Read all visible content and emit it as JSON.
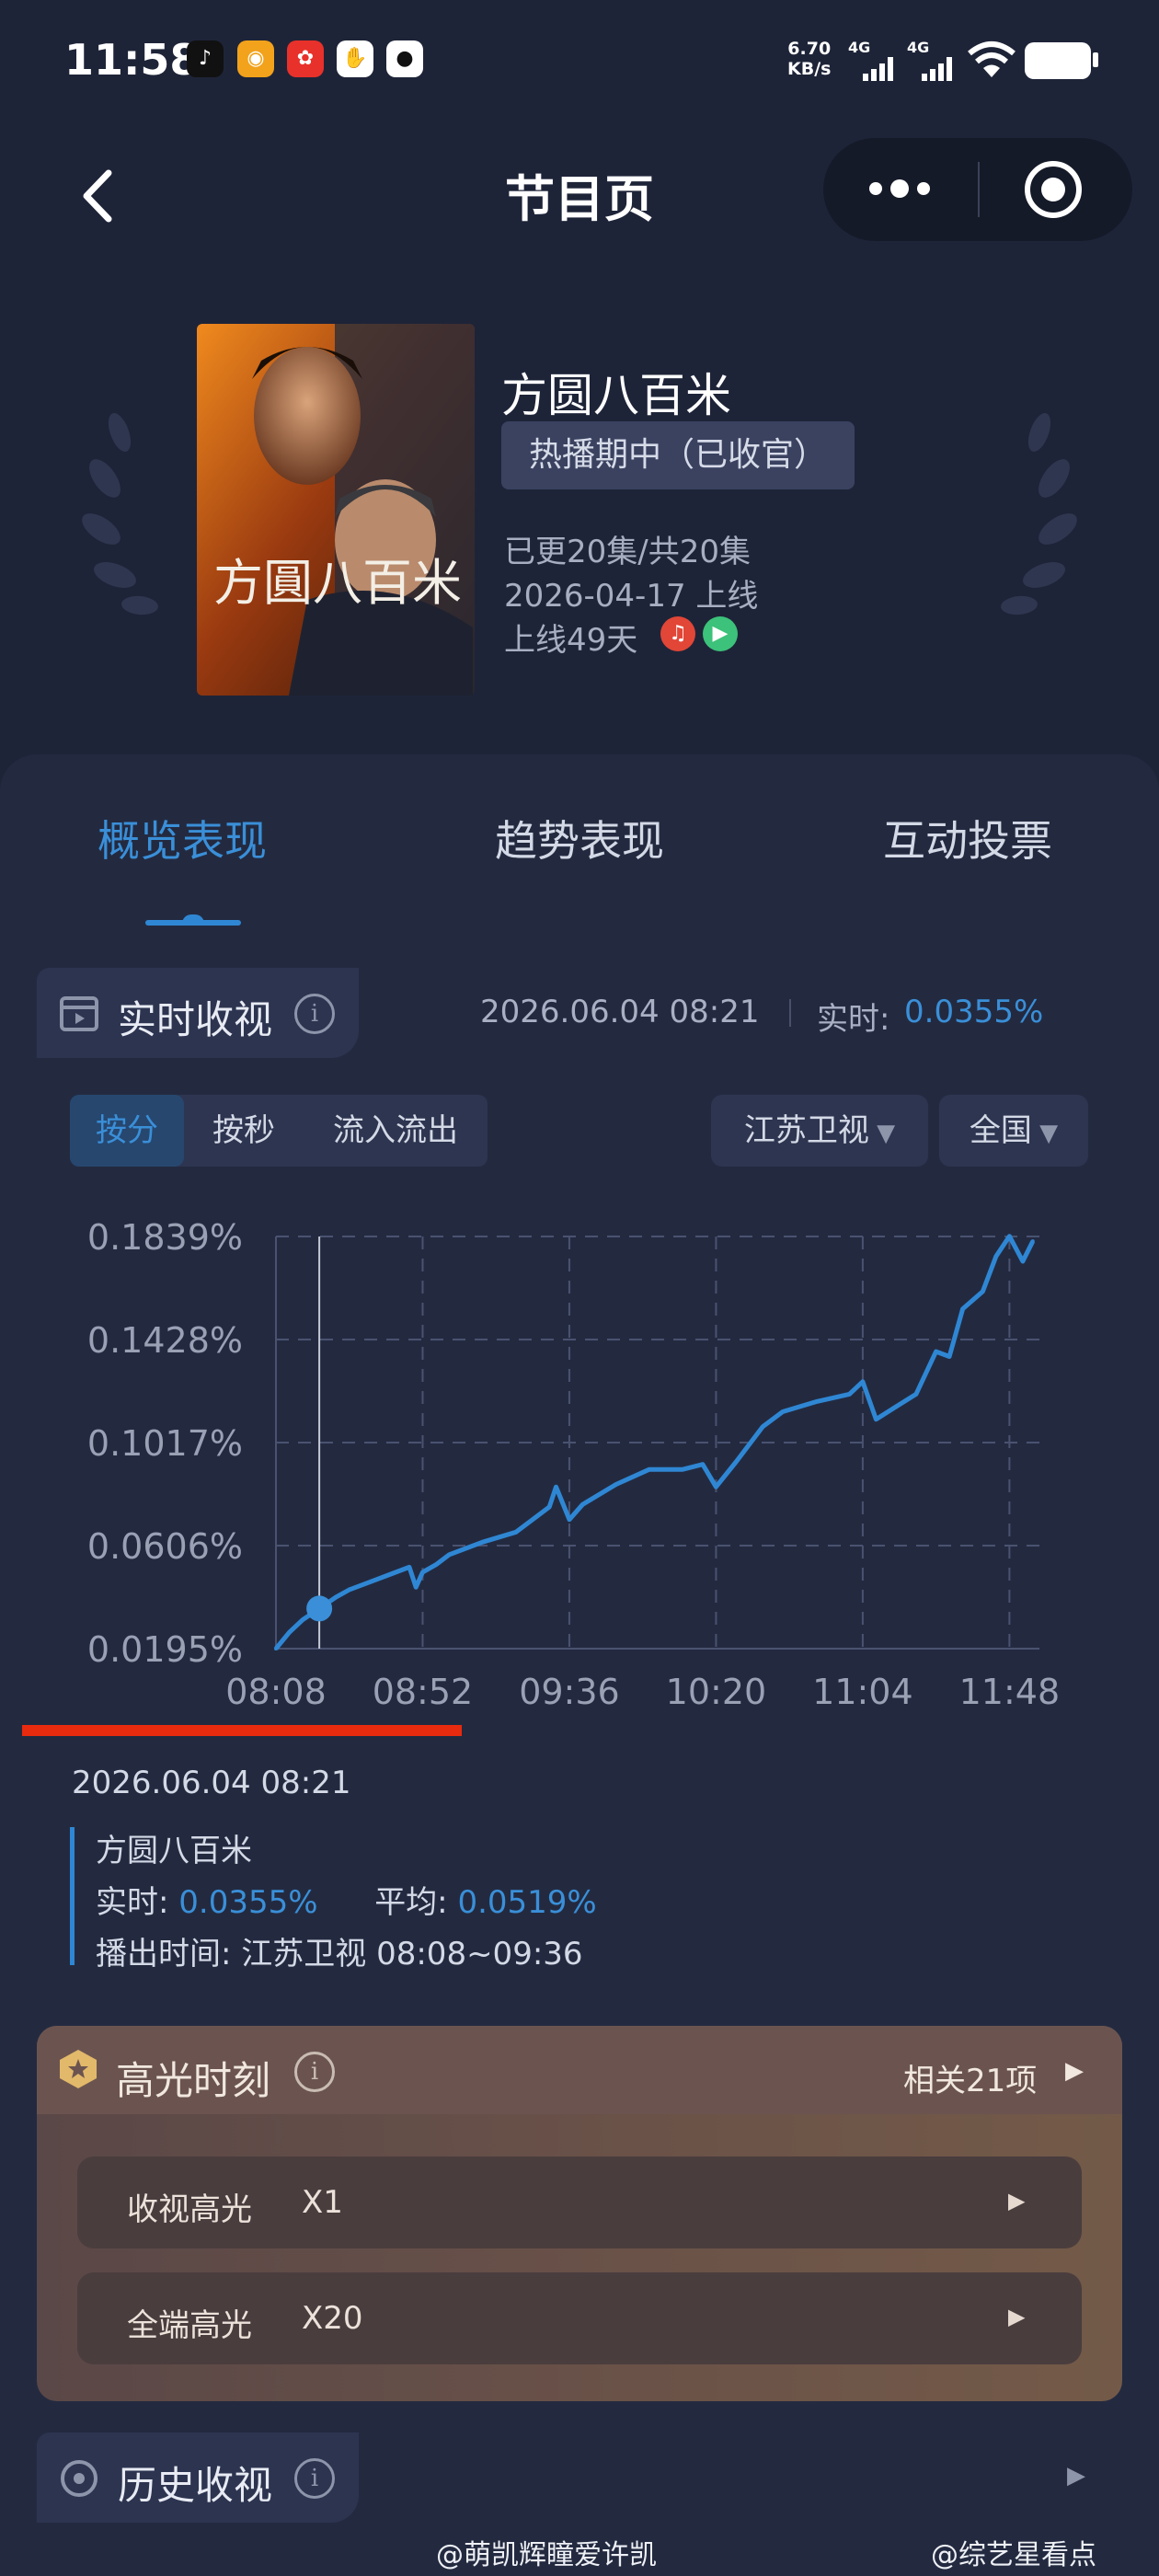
{
  "status_bar": {
    "time": "11:58",
    "net_speed_value": "6.70",
    "net_speed_unit": "KB/s",
    "signal1": "4G",
    "signal2": "4G",
    "apps": [
      "tiktok-icon",
      "weibo-icon",
      "app-red-icon",
      "baidu-icon",
      "qq-icon"
    ]
  },
  "nav": {
    "title": "节目页"
  },
  "show": {
    "title": "方圆八百米",
    "status": "热播期中（已收官）",
    "episodes": "已更20集/共20集",
    "release": "2026-04-17 上线",
    "days_online": "上线49天",
    "poster_title": "方圓八百米"
  },
  "tabs": [
    {
      "label": "概览表现",
      "active": true
    },
    {
      "label": "趋势表现",
      "active": false
    },
    {
      "label": "互动投票",
      "active": false
    }
  ],
  "realtime": {
    "label": "实时收视",
    "timestamp": "2026.06.04 08:21",
    "now_label": "实时:",
    "now_value": "0.0355%",
    "segments": [
      "按分",
      "按秒",
      "流入流出"
    ],
    "channel": "江苏卫视",
    "region": "全国"
  },
  "chart_data": {
    "type": "line",
    "x_ticks": [
      "08:08",
      "08:52",
      "09:36",
      "10:20",
      "11:04",
      "11:48"
    ],
    "y_ticks": [
      "0.1839%",
      "0.1428%",
      "0.1017%",
      "0.0606%",
      "0.0195%"
    ],
    "ylim": [
      0.0195,
      0.1839
    ],
    "xlim": [
      "08:08",
      "11:57"
    ],
    "grid": true,
    "cursor_time": "08:21",
    "series": [
      {
        "x": [
          "08:08",
          "08:12",
          "08:16",
          "08:21",
          "08:26",
          "08:30",
          "08:36",
          "08:42",
          "08:48",
          "08:50",
          "08:52",
          "08:56",
          "09:00",
          "09:10",
          "09:20",
          "09:30",
          "09:32",
          "09:36",
          "09:40",
          "09:50",
          "10:00",
          "10:10",
          "10:16",
          "10:20",
          "10:26",
          "10:34",
          "10:40",
          "10:50",
          "11:00",
          "11:04",
          "11:08",
          "11:14",
          "11:20",
          "11:26",
          "11:30",
          "11:34",
          "11:40",
          "11:44",
          "11:48",
          "11:52",
          "11:55"
        ],
        "values": [
          0.0195,
          0.026,
          0.031,
          0.0355,
          0.04,
          0.043,
          0.046,
          0.049,
          0.052,
          0.044,
          0.05,
          0.053,
          0.057,
          0.062,
          0.066,
          0.076,
          0.084,
          0.071,
          0.077,
          0.085,
          0.091,
          0.091,
          0.093,
          0.084,
          0.094,
          0.108,
          0.114,
          0.118,
          0.121,
          0.126,
          0.111,
          0.116,
          0.121,
          0.138,
          0.136,
          0.155,
          0.162,
          0.176,
          0.184,
          0.174,
          0.182
        ]
      }
    ]
  },
  "tooltip": {
    "date": "2026.06.04 08:21",
    "name": "方圆八百米",
    "now_label": "实时:",
    "now_value": "0.0355%",
    "avg_label": "平均:",
    "avg_value": "0.0519%",
    "air_label": "播出时间:",
    "air_value": "江苏卫视 08:08~09:36"
  },
  "highlight": {
    "title": "高光时刻",
    "related": "相关21项",
    "rows": [
      {
        "label": "收视高光",
        "value": "X1"
      },
      {
        "label": "全端高光",
        "value": "X20"
      }
    ]
  },
  "history": {
    "label": "历史收视"
  },
  "watermark": {
    "left": "@萌凯辉瞳爱许凯",
    "right": "@综艺星看点"
  }
}
